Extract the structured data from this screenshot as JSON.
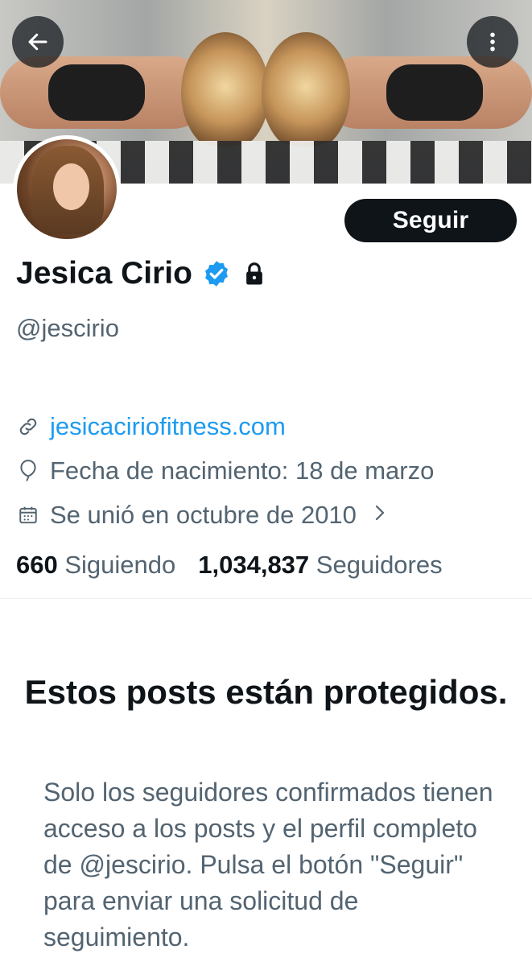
{
  "header": {
    "back_icon": "arrow-left-icon",
    "more_icon": "vertical-ellipsis-icon"
  },
  "profile": {
    "name": "Jesica Cirio",
    "verified_icon": "verified-badge-icon",
    "verified_color": "#1d9bf0",
    "protected_icon": "lock-icon",
    "handle": "@jescirio",
    "follow_label": "Seguir",
    "website": "jesicaciriofitness.com",
    "birth": "Fecha de nacimiento: 18 de marzo",
    "joined": "Se unió en octubre de 2010",
    "following_count": "660",
    "following_label": "Siguiendo",
    "followers_count": "1,034,837",
    "followers_label": "Seguidores"
  },
  "protected_notice": {
    "title": "Estos posts están protegidos.",
    "body": "Solo los seguidores confirmados tienen acceso a los posts y el perfil completo de @jescirio. Pulsa el botón \"Seguir\" para enviar una solicitud de seguimiento."
  },
  "colors": {
    "text_primary": "#0f1419",
    "text_secondary": "#536471",
    "link": "#1d9bf0",
    "button_bg": "#0f1419"
  }
}
